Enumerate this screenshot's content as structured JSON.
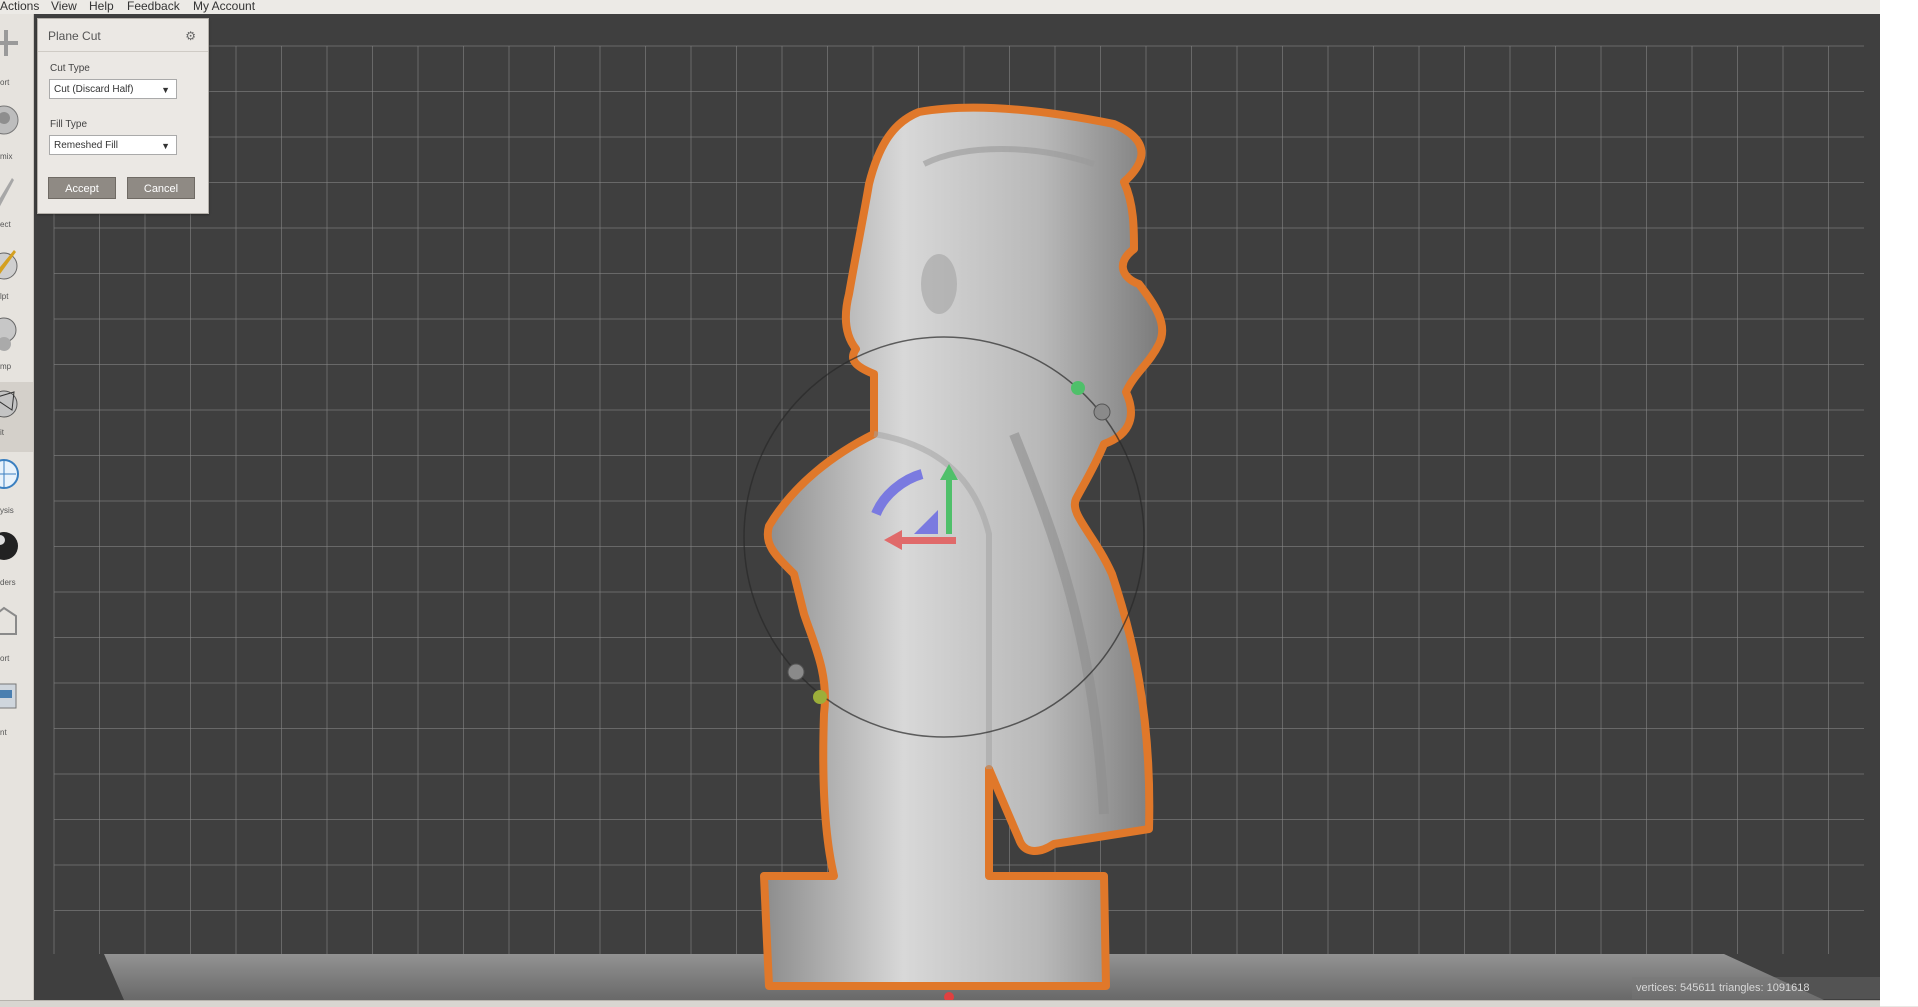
{
  "menubar": {
    "items": [
      "Actions",
      "View",
      "Help",
      "Feedback",
      "My Account"
    ]
  },
  "toolbar": {
    "tools": [
      {
        "label": "ort",
        "icon": "import-icon"
      },
      {
        "label": "mix",
        "icon": "meshmix-icon"
      },
      {
        "label": "ect",
        "icon": "select-icon"
      },
      {
        "label": "lpt",
        "icon": "sculpt-icon"
      },
      {
        "label": "mp",
        "icon": "stamp-icon"
      },
      {
        "label": "it",
        "icon": "edit-icon",
        "active": true
      },
      {
        "label": "ysis",
        "icon": "analysis-icon"
      },
      {
        "label": "ders",
        "icon": "shaders-icon"
      },
      {
        "label": "ort",
        "icon": "export-icon"
      },
      {
        "label": "nt",
        "icon": "print-icon"
      }
    ]
  },
  "panel": {
    "title": "Plane Cut",
    "cut_type_label": "Cut Type",
    "cut_type_value": "Cut (Discard Half)",
    "fill_type_label": "Fill Type",
    "fill_type_value": "Remeshed Fill",
    "accept_label": "Accept",
    "cancel_label": "Cancel"
  },
  "status": {
    "text": "vertices: 545611 triangles: 1091618"
  },
  "colors": {
    "viewport_bg": "#3f3f3f",
    "grid_line": "#8a8a8a",
    "selection_outline": "#e0782a",
    "gizmo_green": "#4fc06a",
    "gizmo_red": "#e06a6a",
    "gizmo_blue": "#7a7ae0"
  }
}
